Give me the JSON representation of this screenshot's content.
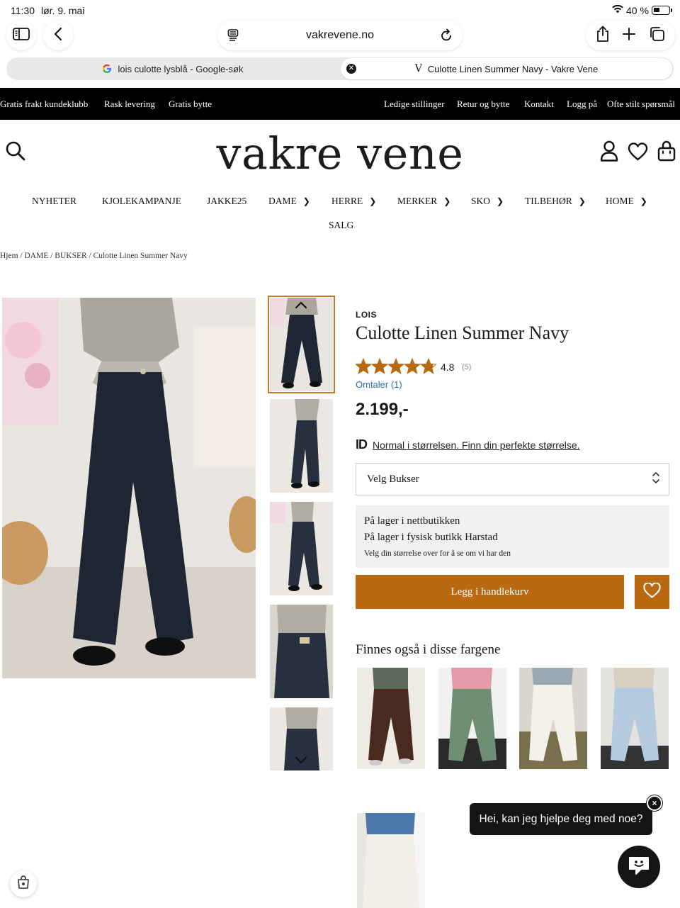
{
  "status_bar": {
    "time": "11:30",
    "date": "lør. 9. mai",
    "battery": "40 %"
  },
  "browser": {
    "url": "vakrevene.no",
    "tabs": [
      {
        "title": "lois culotte lysblå - Google-søk"
      },
      {
        "title": "Culotte Linen Summer Navy - Vakre Vene"
      }
    ],
    "icons": [
      "sidebar-icon",
      "back-icon",
      "reader-icon",
      "reload-icon",
      "share-icon",
      "plus-icon",
      "tabs-icon"
    ]
  },
  "topbar": {
    "left": [
      "Gratis frakt kundeklubb",
      "Rask levering",
      "Gratis bytte"
    ],
    "right": [
      "Ledige stillinger",
      "Retur og bytte",
      "Kontakt",
      "Logg på",
      "Ofte stilt spørsmål"
    ]
  },
  "logo": "vakre vene",
  "nav": {
    "items": [
      "NYHETER",
      "KJOLEKAMPANJE",
      "JAKKE25",
      "DAME",
      "HERRE",
      "MERKER",
      "SKO",
      "TILBEHØR",
      "HOME",
      "SALG"
    ]
  },
  "breadcrumb": "Hjem / DAME / BUKSER / Culotte Linen Summer Navy",
  "product": {
    "brand": "LOIS",
    "title": "Culotte Linen Summer Navy",
    "rating": "4.8",
    "rating_value": 4.8,
    "rating_count": "(5)",
    "reviews_link": "Omtaler (1)",
    "price": "2.199,-",
    "fit_logo": "ID",
    "fit_text": "Normal i størrelsen. Finn din perfekte størrelse.",
    "size_select": "Velg Bukser",
    "stock_line1": "På lager i nettbutikken",
    "stock_line2": "På lager i fysisk butikk Harstad",
    "stock_note": "Velg din størrelse over for å se om vi har den",
    "add_to_cart": "Legg i handlekurv",
    "colors_heading": "Finnes også i disse fargene",
    "accent_color": "#b86912"
  },
  "chat": {
    "prompt": "Hei, kan jeg hjelpe deg med noe?",
    "close": "×"
  }
}
